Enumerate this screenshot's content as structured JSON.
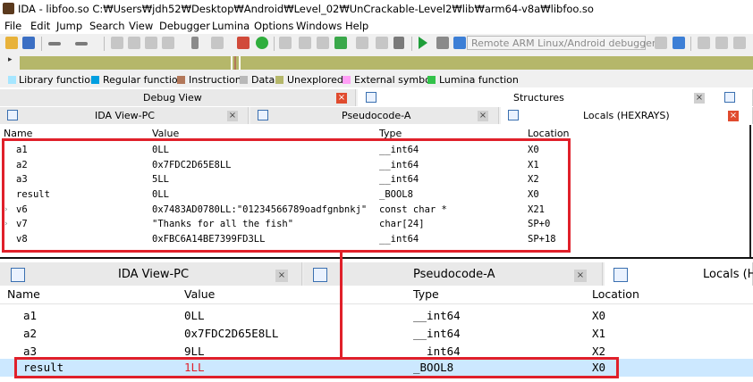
{
  "window": {
    "title": "IDA - libfoo.so C:₩Users₩jdh52₩Desktop₩Android₩Level_02₩UnCrackable-Level2₩lib₩arm64-v8a₩libfoo.so"
  },
  "menu": [
    "File",
    "Edit",
    "Jump",
    "Search",
    "View",
    "Debugger",
    "Lumina",
    "Options",
    "Windows",
    "Help"
  ],
  "toolbar": {
    "debugger_select": "Remote ARM Linux/Android debugger"
  },
  "legend": [
    {
      "label": "Library function",
      "color": "#a6e6ff"
    },
    {
      "label": "Regular function",
      "color": "#009fe0"
    },
    {
      "label": "Instruction",
      "color": "#b3785a"
    },
    {
      "label": "Data",
      "color": "#b9b9b9"
    },
    {
      "label": "Unexplored",
      "color": "#b5b76a"
    },
    {
      "label": "External symbol",
      "color": "#ff9ef5"
    },
    {
      "label": "Lumina function",
      "color": "#33c24a"
    }
  ],
  "top_tabs": {
    "debug_view": "Debug View",
    "structures": "Structures"
  },
  "tabs": {
    "ida_view": "IDA View-PC",
    "pseudocode": "Pseudocode-A",
    "locals": "Locals (HEXRAYS)",
    "locals_trunc": "Locals (H"
  },
  "columns": {
    "name": "Name",
    "value": "Value",
    "type": "Type",
    "location": "Location"
  },
  "locals_top": [
    {
      "name": "a1",
      "value": "0LL",
      "type": "__int64",
      "location": "X0"
    },
    {
      "name": "a2",
      "value": "0x7FDC2D65E8LL",
      "type": "__int64",
      "location": "X1"
    },
    {
      "name": "a3",
      "value": "5LL",
      "type": "__int64",
      "location": "X2"
    },
    {
      "name": "result",
      "value": "0LL",
      "type": "_BOOL8",
      "location": "X0"
    },
    {
      "name": "v6",
      "value": "0x7483AD0780LL:\"01234566789oadfgnbnkj\"",
      "type": "const char *",
      "location": "X21"
    },
    {
      "name": "v7",
      "value": "\"Thanks for all the fish\"",
      "type": "char[24]",
      "location": "SP+0"
    },
    {
      "name": "v8",
      "value": "0xFBC6A14BE7399FD3LL",
      "type": "__int64",
      "location": "SP+18"
    }
  ],
  "locals_bottom": [
    {
      "name": "a1",
      "value": "0LL",
      "type": "__int64",
      "location": "X0"
    },
    {
      "name": "a2",
      "value": "0x7FDC2D65E8LL",
      "type": "__int64",
      "location": "X1"
    },
    {
      "name": "a3",
      "value": "9LL",
      "type": "__int64",
      "location": "X2"
    },
    {
      "name": "result",
      "value": "1LL",
      "type": "_BOOL8",
      "location": "X0"
    }
  ],
  "colors": {
    "highlight": "#e0202a",
    "selected_row": "#cce8ff",
    "changed_value": "#e0202a"
  }
}
